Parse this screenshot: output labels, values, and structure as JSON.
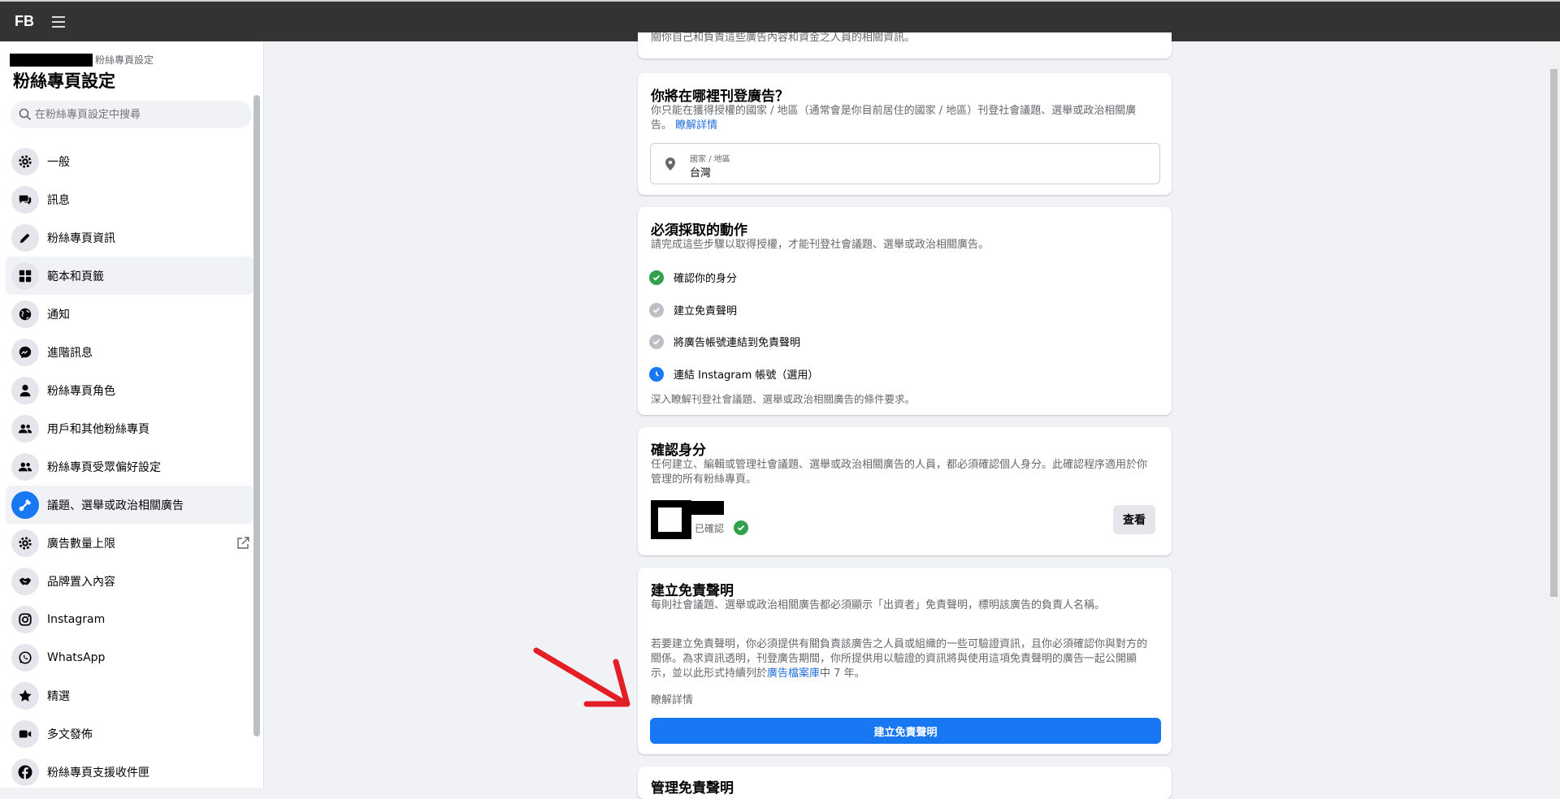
{
  "topbar": {
    "logo": "FB"
  },
  "sidebar": {
    "breadcrumb": "粉絲專頁設定",
    "title": "粉絲專頁設定",
    "search_placeholder": "在粉絲專頁設定中搜尋",
    "items": [
      {
        "label": "一般",
        "icon": "gear-icon"
      },
      {
        "label": "訊息",
        "icon": "chat-icon"
      },
      {
        "label": "粉絲專頁資訊",
        "icon": "pencil-icon"
      },
      {
        "label": "範本和頁籤",
        "icon": "grid-icon"
      },
      {
        "label": "通知",
        "icon": "globe-icon"
      },
      {
        "label": "進階訊息",
        "icon": "messenger-icon"
      },
      {
        "label": "粉絲專頁角色",
        "icon": "person-icon"
      },
      {
        "label": "用戶和其他粉絲專頁",
        "icon": "people-icon"
      },
      {
        "label": "粉絲專頁受眾偏好設定",
        "icon": "people-icon"
      },
      {
        "label": "議題、選舉或政治相關廣告",
        "icon": "megaphone-icon"
      },
      {
        "label": "廣告數量上限",
        "icon": "gear-icon"
      },
      {
        "label": "品牌置入內容",
        "icon": "handshake-icon"
      },
      {
        "label": "Instagram",
        "icon": "instagram-icon"
      },
      {
        "label": "WhatsApp",
        "icon": "whatsapp-icon"
      },
      {
        "label": "精選",
        "icon": "star-icon"
      },
      {
        "label": "多文發佈",
        "icon": "video-icon"
      },
      {
        "label": "粉絲專頁支援收件匣",
        "icon": "facebook-icon"
      }
    ]
  },
  "top_fragment": "關你自己和負責這些廣告內容和資金之人員的相關資訊。",
  "where_card": {
    "title": "你將在哪裡刊登廣告？",
    "desc": "你只能在獲得授權的國家 / 地區（通常會是你目前居住的國家 / 地區）刊登社會議題、選舉或政治相關廣告。",
    "link": "瞭解詳情",
    "field_label": "國家 / 地區",
    "field_value": "台灣"
  },
  "actions_card": {
    "title": "必須採取的動作",
    "desc": "請完成這些步驟以取得授權，才能刊登社會議題、選舉或政治相關廣告。",
    "steps": [
      {
        "label": "確認你的身分",
        "status": "done"
      },
      {
        "label": "建立免責聲明",
        "status": "pending"
      },
      {
        "label": "將廣告帳號連結到免責聲明",
        "status": "pending"
      },
      {
        "label": "連結 Instagram 帳號（選用）",
        "status": "optional"
      }
    ],
    "link": "深入瞭解刊登社會議題、選舉或政治相關廣告的條件要求。"
  },
  "identity_card": {
    "title": "確認身分",
    "desc": "任何建立、編輯或管理社會議題、選舉或政治相關廣告的人員，都必須確認個人身分。此確認程序適用於你管理的所有粉絲專頁。",
    "status": "已確認",
    "button": "查看"
  },
  "disclaimer_card": {
    "title": "建立免責聲明",
    "desc1": "每則社會議題、選舉或政治相關廣告都必須顯示「出資者」免責聲明，標明該廣告的負責人名稱。",
    "desc2_a": "若要建立免責聲明，你必須提供有關負責該廣告之人員或組織的一些可驗證資訊，且你必須確認你與對方的關係。為求資訊透明，刊登廣告期間，你所提供用以驗證的資訊將與使用這項免責聲明的廣告一起公開顯示，並以此形式持續列於",
    "desc2_link": "廣告檔案庫",
    "desc2_b": "中 7 年。",
    "link": "瞭解詳情",
    "button": "建立免責聲明"
  },
  "manage_card": {
    "title": "管理免責聲明"
  },
  "colors": {
    "primary": "#1877f2",
    "success": "#31a24c",
    "link": "#216fdb",
    "arrow": "#e41e26"
  }
}
